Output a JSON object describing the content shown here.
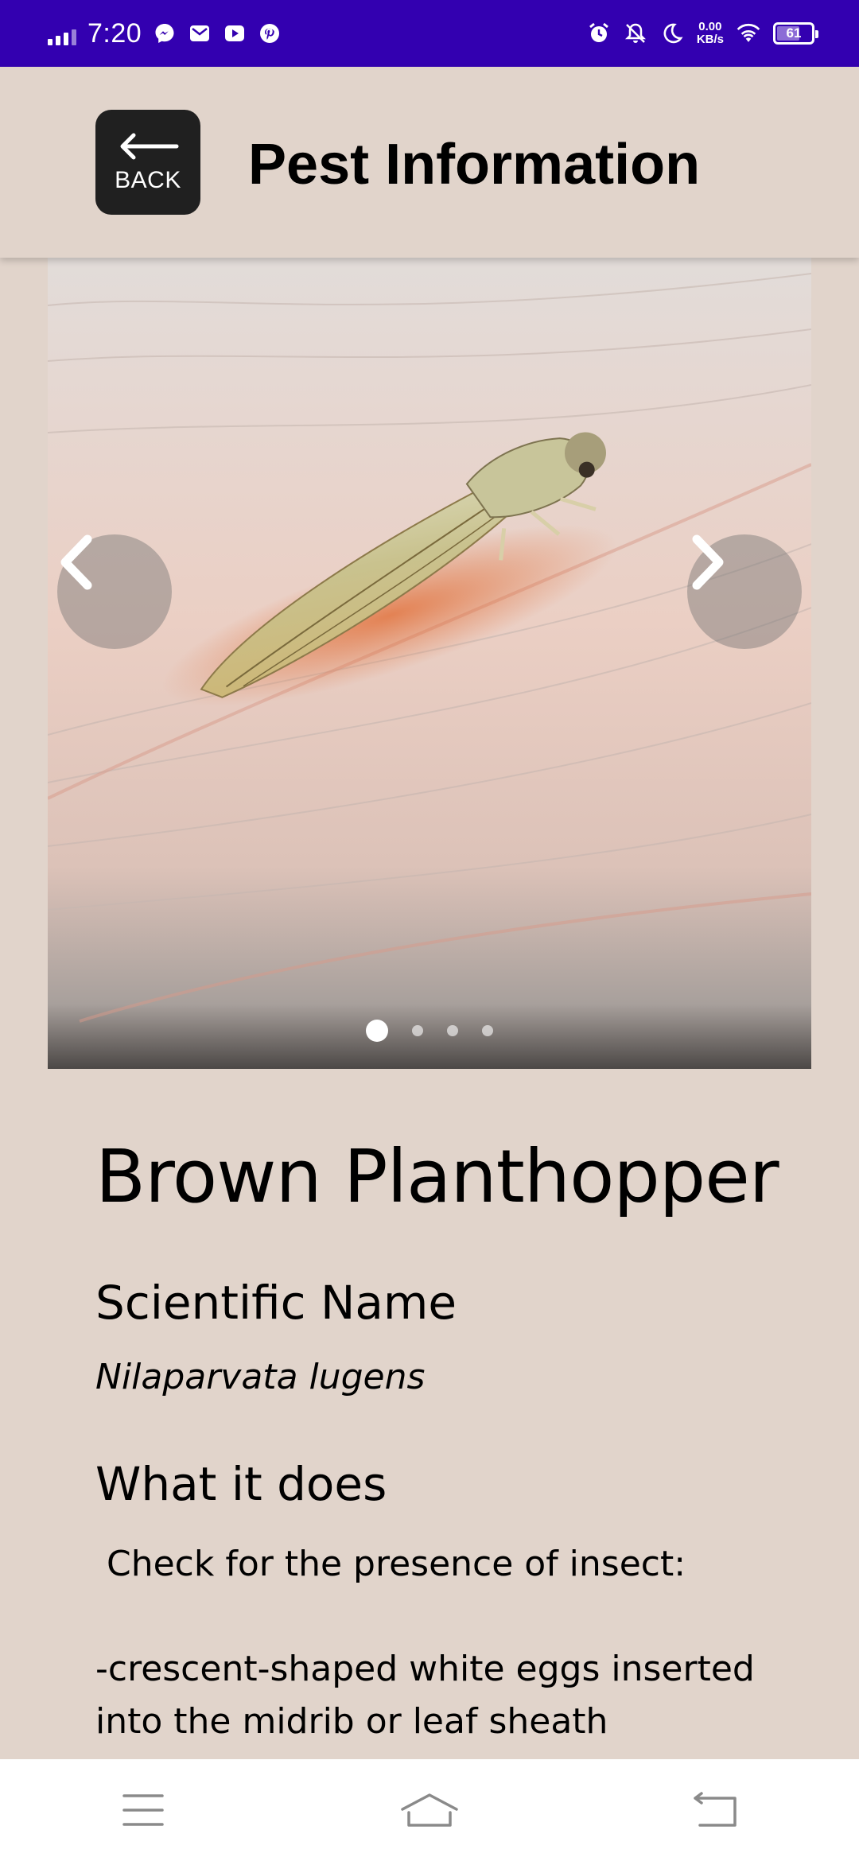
{
  "status_bar": {
    "time": "7:20",
    "net_speed_value": "0.00",
    "net_speed_unit": "KB/s",
    "battery": "61",
    "icons": [
      "signal-icon",
      "messenger-icon",
      "mail-icon",
      "youtube-icon",
      "pinterest-icon",
      "alarm-icon",
      "mute-icon",
      "moon-icon",
      "wifi-icon",
      "battery-icon"
    ]
  },
  "header": {
    "back_label": "BACK",
    "title": "Pest Information"
  },
  "carousel": {
    "image_subject": "planthopper on skin",
    "slide_count": 4,
    "active_slide": 1
  },
  "pest": {
    "name": "Brown Planthopper",
    "scientific_heading": "Scientific Name",
    "scientific_name": "Nilaparvata lugens",
    "what_heading": "What it does",
    "description": " Check for the presence of insect:\n\n-crescent-shaped white eggs inserted into the midrib or leaf sheath"
  },
  "bottom_nav": {
    "icons": [
      "menu-icon",
      "home-icon",
      "back-nav-icon"
    ]
  },
  "colors": {
    "status_bar": "#3300b0",
    "background": "#e1d4cb",
    "back_button": "#202020"
  }
}
